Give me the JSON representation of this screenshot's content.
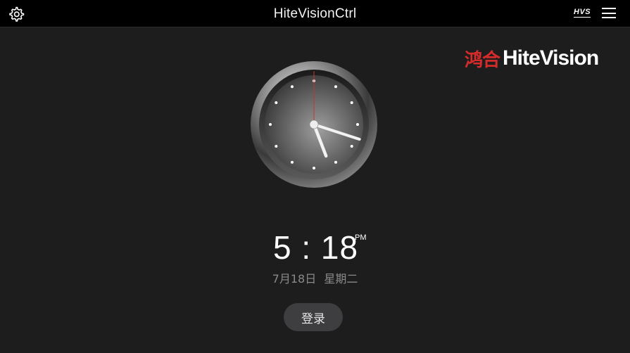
{
  "header": {
    "title": "HiteVisionCtrl",
    "settings_icon": "gear-icon",
    "badge": "HVS",
    "menu_icon": "hamburger-menu-icon"
  },
  "brand": {
    "logo_cn": "鸿合",
    "logo_en": "HiteVision",
    "cn_color": "#d62b2b"
  },
  "clock": {
    "hour": 5,
    "minute": 18,
    "second": 0
  },
  "time": {
    "display": "5 : 18",
    "period": "PM"
  },
  "date": {
    "day": "7月18日",
    "weekday": "星期二"
  },
  "actions": {
    "login_label": "登录"
  },
  "colors": {
    "background": "#1d1d1e",
    "topbar": "#000000",
    "second_hand": "#c0392b",
    "button": "#3e3e40"
  }
}
